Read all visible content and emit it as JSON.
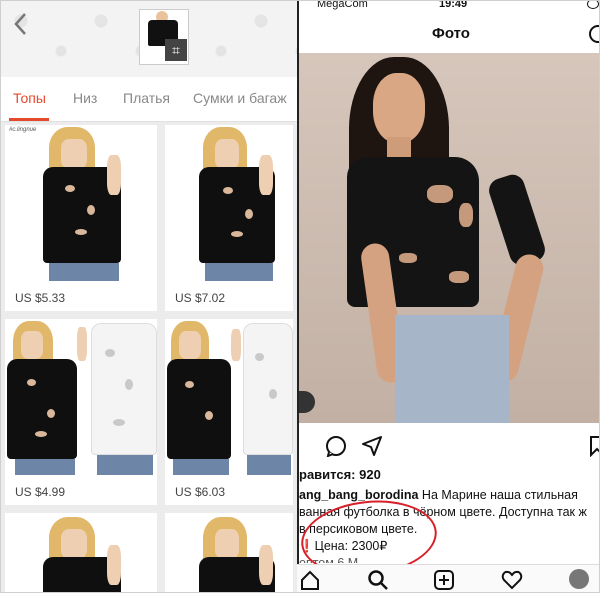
{
  "left_app": {
    "back_icon": "chevron-left-icon",
    "crop_icon": "crop-icon",
    "tabs": [
      {
        "label": "Топы",
        "active": true
      },
      {
        "label": "Низ",
        "active": false
      },
      {
        "label": "Платья",
        "active": false
      },
      {
        "label": "Сумки и багаж",
        "active": false
      }
    ],
    "accent_color": "#e64a2e",
    "products": [
      {
        "price": "US $5.33",
        "watermark": "#c.lingnue"
      },
      {
        "price": "US $7.02"
      },
      {
        "price": "US $4.99"
      },
      {
        "price": "US $6.03"
      },
      {
        "price": ""
      },
      {
        "price": ""
      }
    ]
  },
  "right_app": {
    "status_bar": {
      "carrier": "MegaCom",
      "time": "19:49"
    },
    "title": "Фото",
    "likes": "равится: 920",
    "caption": {
      "username": "ang_bang_borodina",
      "line1_text": " На Марине наша стильная",
      "line2": "ванная футболка в чёрном цвете. Доступна так ж",
      "line3": "в персиковом цвете.",
      "price_mark": "❗",
      "price": "Цена: 2300₽",
      "line5": "оптом 6 М"
    },
    "highlight_color": "#d8202a"
  }
}
